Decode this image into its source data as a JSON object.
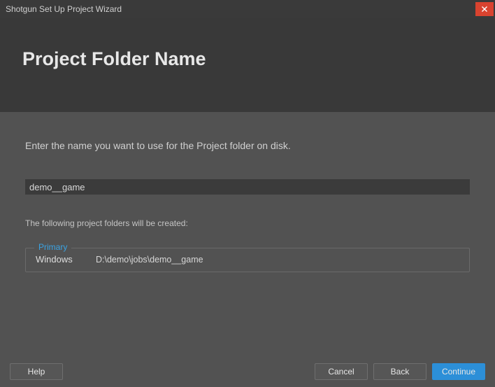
{
  "window": {
    "title": "Shotgun Set Up Project Wizard"
  },
  "header": {
    "title": "Project Folder Name"
  },
  "main": {
    "instruction": "Enter the name you want to use for the Project folder on disk.",
    "folder_name_value": "demo__game",
    "subnote": "The following project folders will be created:",
    "group": {
      "legend": "Primary",
      "os_label": "Windows",
      "path": "D:\\demo\\jobs\\demo__game"
    }
  },
  "footer": {
    "help": "Help",
    "cancel": "Cancel",
    "back": "Back",
    "continue": "Continue"
  }
}
